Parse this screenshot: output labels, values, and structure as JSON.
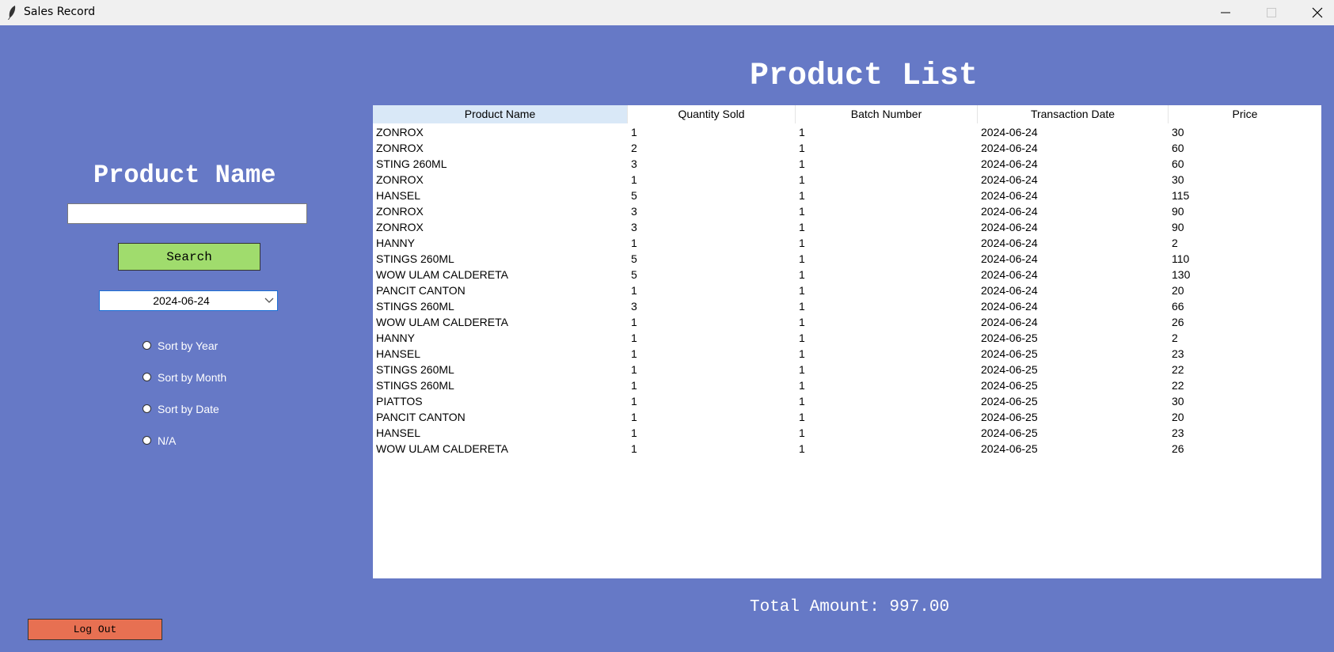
{
  "window": {
    "title": "Sales Record"
  },
  "left_panel": {
    "product_name_title": "Product Name",
    "search_input_value": "",
    "search_button_label": "Search",
    "date_select_value": "2024-06-24",
    "sort_options": [
      "Sort by Year",
      "Sort by Month",
      "Sort by Date",
      "N/A"
    ],
    "logout_label": "Log Out"
  },
  "main": {
    "title": "Product List",
    "columns": [
      "Product Name",
      "Quantity Sold",
      "Batch Number",
      "Transaction Date",
      "Price"
    ],
    "rows": [
      [
        "ZONROX",
        "1",
        "1",
        "2024-06-24",
        "30"
      ],
      [
        "ZONROX",
        "2",
        "1",
        "2024-06-24",
        "60"
      ],
      [
        "STING 260ML",
        "3",
        "1",
        "2024-06-24",
        "60"
      ],
      [
        "ZONROX",
        "1",
        "1",
        "2024-06-24",
        "30"
      ],
      [
        "HANSEL",
        "5",
        "1",
        "2024-06-24",
        "115"
      ],
      [
        "ZONROX",
        "3",
        "1",
        "2024-06-24",
        "90"
      ],
      [
        "ZONROX",
        "3",
        "1",
        "2024-06-24",
        "90"
      ],
      [
        "HANNY",
        "1",
        "1",
        "2024-06-24",
        "2"
      ],
      [
        "STINGS 260ML",
        "5",
        "1",
        "2024-06-24",
        "110"
      ],
      [
        "WOW ULAM CALDERETA",
        "5",
        "1",
        "2024-06-24",
        "130"
      ],
      [
        "PANCIT CANTON",
        "1",
        "1",
        "2024-06-24",
        "20"
      ],
      [
        "STINGS 260ML",
        "3",
        "1",
        "2024-06-24",
        "66"
      ],
      [
        "WOW ULAM CALDERETA",
        "1",
        "1",
        "2024-06-24",
        "26"
      ],
      [
        "HANNY",
        "1",
        "1",
        "2024-06-25",
        "2"
      ],
      [
        "HANSEL",
        "1",
        "1",
        "2024-06-25",
        "23"
      ],
      [
        "STINGS 260ML",
        "1",
        "1",
        "2024-06-25",
        "22"
      ],
      [
        "STINGS 260ML",
        "1",
        "1",
        "2024-06-25",
        "22"
      ],
      [
        "PIATTOS",
        "1",
        "1",
        "2024-06-25",
        "30"
      ],
      [
        "PANCIT CANTON",
        "1",
        "1",
        "2024-06-25",
        "20"
      ],
      [
        "HANSEL",
        "1",
        "1",
        "2024-06-25",
        "23"
      ],
      [
        "WOW ULAM CALDERETA",
        "1",
        "1",
        "2024-06-25",
        "26"
      ]
    ],
    "total_amount": "Total Amount: 997.00"
  },
  "colors": {
    "background": "#6679c6",
    "search_button": "#a0dc6d",
    "logout_button": "#e77052",
    "active_header": "#d9e8f7"
  },
  "icons": [
    "feather-icon",
    "minimize-icon",
    "maximize-icon",
    "close-icon",
    "chevron-down-icon"
  ]
}
